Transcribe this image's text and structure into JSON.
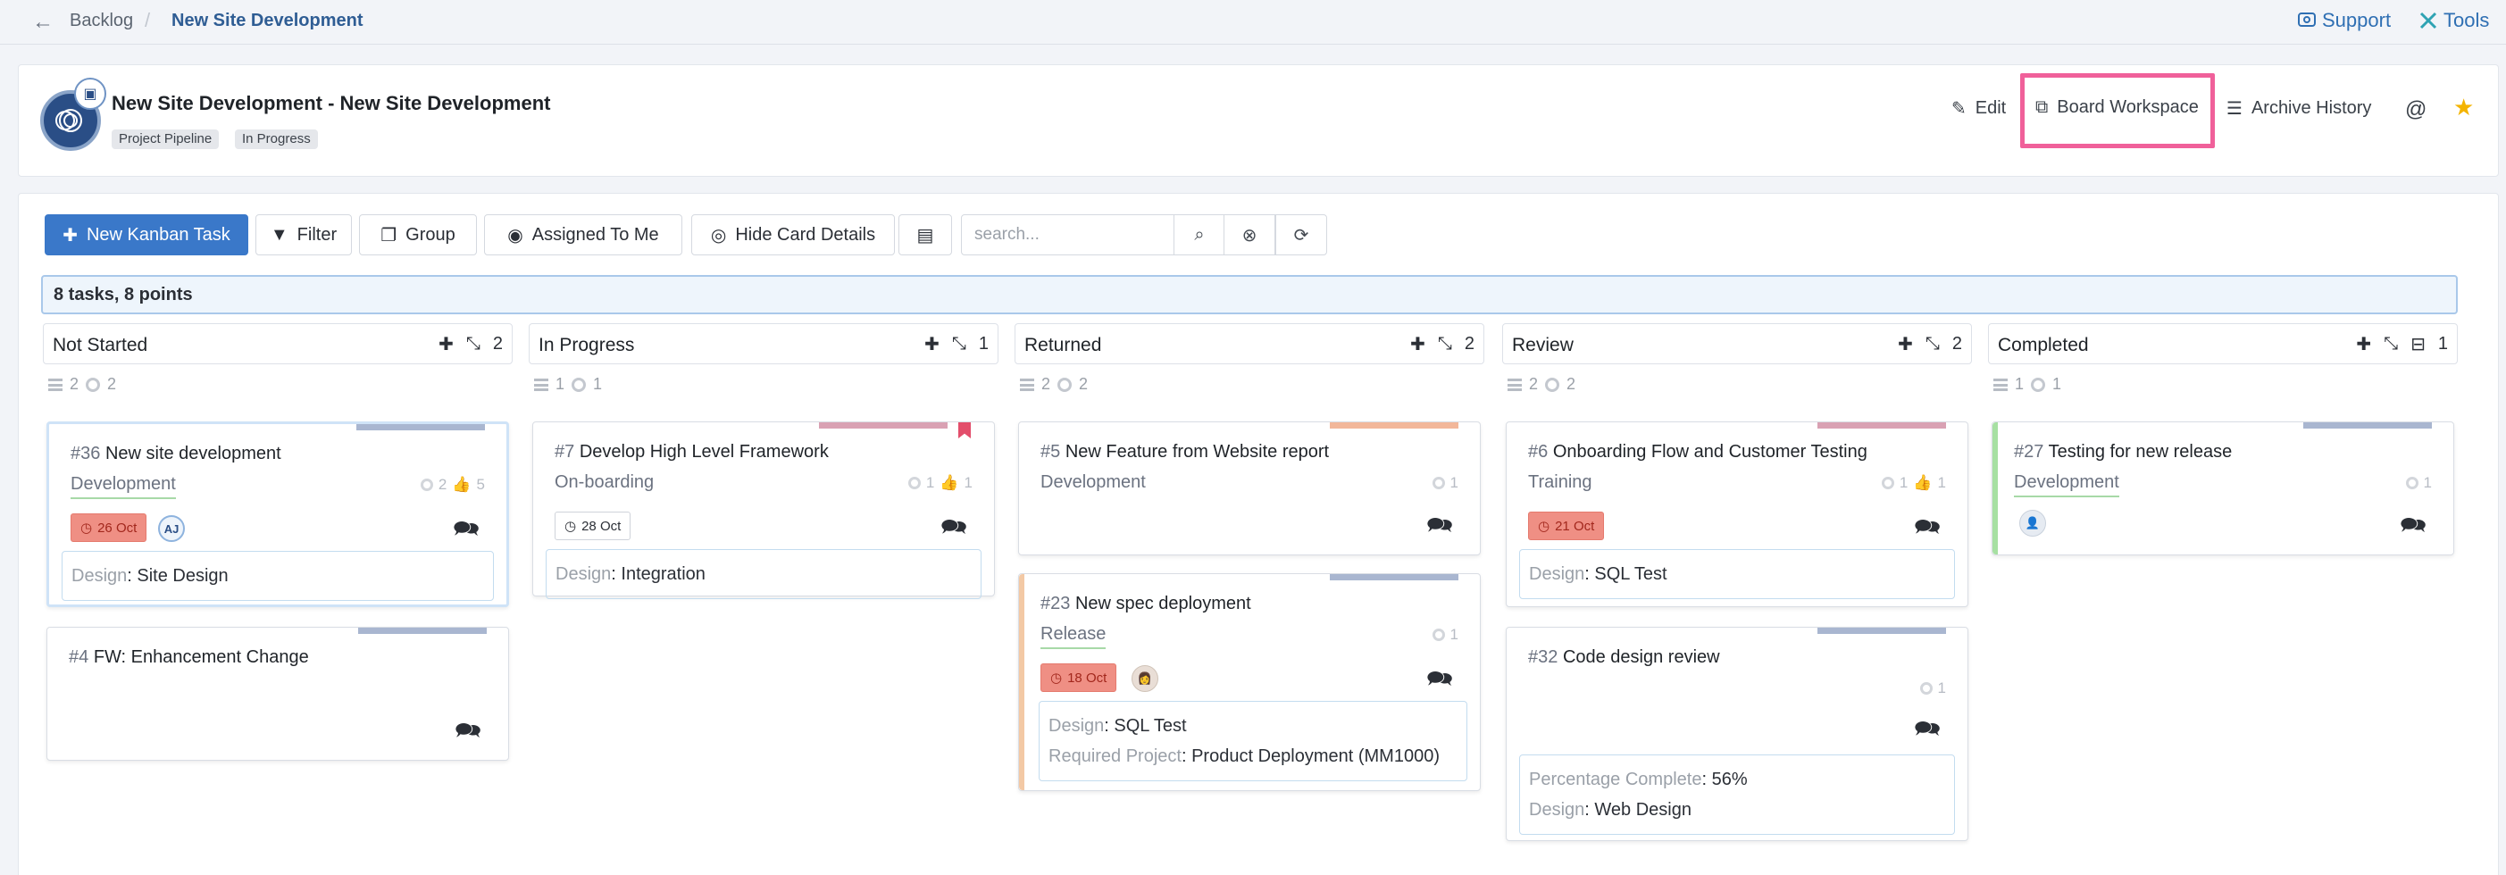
{
  "breadcrumb": {
    "back": "Backlog",
    "current": "New Site Development"
  },
  "topnav": {
    "support": "Support",
    "tools": "Tools"
  },
  "project": {
    "title": "New Site Development - New Site Development",
    "tags": [
      "Project Pipeline",
      "In Progress"
    ]
  },
  "header_actions": {
    "edit": "Edit",
    "board_workspace": "Board Workspace",
    "archive_history": "Archive History"
  },
  "toolbar": {
    "new_task": "New Kanban Task",
    "filter": "Filter",
    "group": "Group",
    "assigned": "Assigned To Me",
    "hide_details": "Hide Card Details",
    "search_placeholder": "search..."
  },
  "summary": "8 tasks, 8 points",
  "columns": [
    {
      "title": "Not Started",
      "count": "2",
      "stat_a": "2",
      "stat_b": "2"
    },
    {
      "title": "In Progress",
      "count": "1",
      "stat_a": "1",
      "stat_b": "1"
    },
    {
      "title": "Returned",
      "count": "2",
      "stat_a": "2",
      "stat_b": "2"
    },
    {
      "title": "Review",
      "count": "2",
      "stat_a": "2",
      "stat_b": "2"
    },
    {
      "title": "Completed",
      "count": "1",
      "stat_a": "1",
      "stat_b": "1"
    }
  ],
  "cards": {
    "c36": {
      "num": "#36",
      "title": "New site development",
      "type": "Development",
      "points": "2",
      "likes": "5",
      "date": "26 Oct",
      "avatar": "AJ",
      "detail_label": "Design",
      "detail_value": "Site Design"
    },
    "c4": {
      "num": "#4",
      "title": "FW: Enhancement Change"
    },
    "c7": {
      "num": "#7",
      "title": "Develop High Level Framework",
      "type": "On-boarding",
      "points": "1",
      "likes": "1",
      "date": "28 Oct",
      "detail_label": "Design",
      "detail_value": "Integration"
    },
    "c5": {
      "num": "#5",
      "title": "New Feature from Website report",
      "type": "Development",
      "points": "1"
    },
    "c23": {
      "num": "#23",
      "title": "New spec deployment",
      "type": "Release",
      "points": "1",
      "date": "18 Oct",
      "detail_label": "Design",
      "detail_value": "SQL Test",
      "detail2_label": "Required Project",
      "detail2_value": "Product Deployment (MM1000)"
    },
    "c6": {
      "num": "#6",
      "title": "Onboarding Flow and Customer Testing",
      "type": "Training",
      "points": "1",
      "likes": "1",
      "date": "21 Oct",
      "detail_label": "Design",
      "detail_value": "SQL Test"
    },
    "c32": {
      "num": "#32",
      "title": "Code design review",
      "points": "1",
      "detail_label": "Percentage Complete",
      "detail_value": "56%",
      "detail2_label": "Design",
      "detail2_value": "Web Design"
    },
    "c27": {
      "num": "#27",
      "title": "Testing for new release",
      "type": "Development",
      "points": "1"
    }
  },
  "colors": {
    "primary": "#3a78c9",
    "highlight": "#f0609a",
    "stripe_blue": "#a9b6d0",
    "stripe_pink": "#d9a1b3",
    "stripe_orange": "#f2b79a",
    "bar_orange": "#f3c9a5",
    "bar_green": "#a7e0a2"
  },
  "icons": [
    "back-arrow-icon",
    "support-icon",
    "tools-icon",
    "pencil-icon",
    "external-link-icon",
    "sliders-icon",
    "at-icon",
    "star-icon",
    "plus-icon",
    "filter-icon",
    "copy-icon",
    "user-icon",
    "eye-icon",
    "excel-icon",
    "search-icon",
    "clear-icon",
    "refresh-icon",
    "collapse-icon",
    "archive-icon",
    "comment-icon",
    "bookmark-icon",
    "clock-icon"
  ]
}
